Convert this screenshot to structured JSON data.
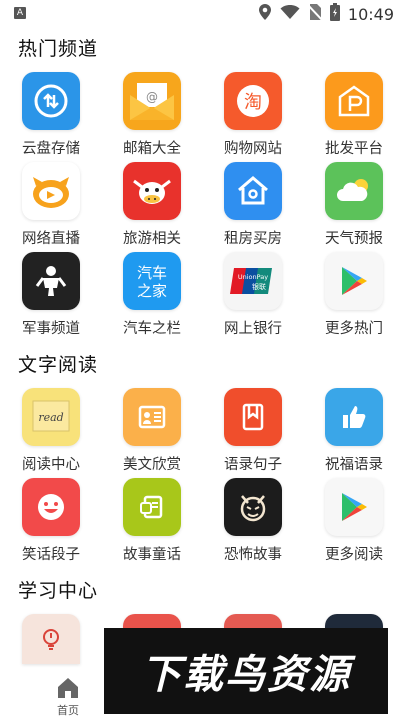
{
  "status_bar": {
    "left_badge": "A",
    "time": "10:49"
  },
  "sections": [
    {
      "title": "热门频道",
      "items": [
        {
          "label": "云盘存储",
          "icon": "cloud-sync-icon",
          "color": "#2b95e8"
        },
        {
          "label": "邮箱大全",
          "icon": "mail-icon",
          "color": "#f7a61c"
        },
        {
          "label": "购物网站",
          "icon": "taobao-icon",
          "color": "#f55a2c"
        },
        {
          "label": "批发平台",
          "icon": "store-icon",
          "color": "#fc9a1c"
        },
        {
          "label": "网络直播",
          "icon": "live-mascot-icon",
          "color": "#ffffff"
        },
        {
          "label": "旅游相关",
          "icon": "cow-icon",
          "color": "#e8322c"
        },
        {
          "label": "租房买房",
          "icon": "house-icon",
          "color": "#2f8ff0"
        },
        {
          "label": "天气预报",
          "icon": "weather-icon",
          "color": "#5cc25a"
        },
        {
          "label": "军事频道",
          "icon": "soldier-icon",
          "color": "#222222"
        },
        {
          "label": "汽车之栏",
          "icon": "car-home-icon",
          "color": "#1f9af0"
        },
        {
          "label": "网上银行",
          "icon": "unionpay-icon",
          "color": "#f5f5f5"
        },
        {
          "label": "更多热门",
          "icon": "play-store-icon",
          "color": "#f7f7f7"
        }
      ]
    },
    {
      "title": "文字阅读",
      "items": [
        {
          "label": "阅读中心",
          "icon": "read-note-icon",
          "color": "#f8e27a"
        },
        {
          "label": "美文欣赏",
          "icon": "article-icon",
          "color": "#fbb04a"
        },
        {
          "label": "语录句子",
          "icon": "bookmark-icon",
          "color": "#f04e2c"
        },
        {
          "label": "祝福语录",
          "icon": "thumbs-up-icon",
          "color": "#3aa6e8"
        },
        {
          "label": "笑话段子",
          "icon": "smile-icon",
          "color": "#f24a4a"
        },
        {
          "label": "故事童话",
          "icon": "story-icon",
          "color": "#a8c71a"
        },
        {
          "label": "恐怖故事",
          "icon": "devil-icon",
          "color": "#1c1c1c"
        },
        {
          "label": "更多阅读",
          "icon": "play-store-icon",
          "color": "#f7f7f7"
        }
      ]
    },
    {
      "title": "学习中心",
      "items": []
    }
  ],
  "icon_texts": {
    "mail_at": "@",
    "taobao": "淘",
    "car_home_1": "汽车",
    "car_home_2": "之家",
    "unionpay_1": "UnionPay",
    "unionpay_2": "银联",
    "read": "read"
  },
  "banner": {
    "text": "下载鸟资源"
  },
  "bottom_nav": {
    "home_label": "首页"
  }
}
